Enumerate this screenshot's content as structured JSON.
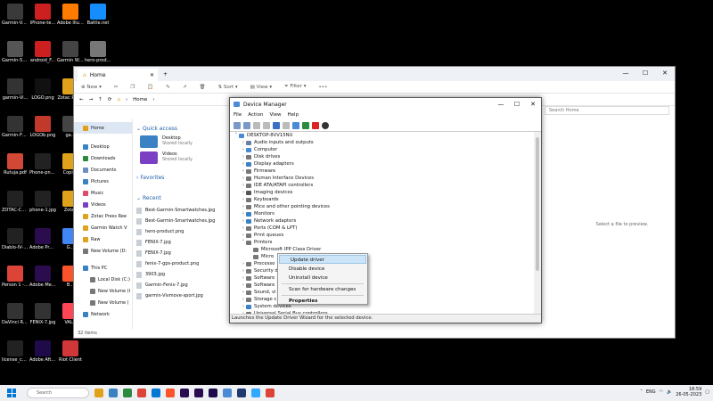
{
  "desktop_icons": [
    {
      "label": "Garmin-Venu-SQ-2.jpg",
      "color": "#3a3a3a"
    },
    {
      "label": "iPhone-te...",
      "color": "#cc1f1f"
    },
    {
      "label": "Adobe Illustrat...",
      "color": "#ff7c00"
    },
    {
      "label": "Battle.net",
      "color": "#148eff"
    },
    {
      "label": "Garmin-55...",
      "color": "#555"
    },
    {
      "label": "android_F...",
      "color": "#cc1f1f"
    },
    {
      "label": "Garmin Watch",
      "color": "#444"
    },
    {
      "label": "hero-produ...",
      "color": "#777"
    },
    {
      "label": "garmin-Vi...",
      "color": "#333"
    },
    {
      "label": "LOGO.png",
      "color": "#111"
    },
    {
      "label": "Zotac Press",
      "color": "#e0a21a"
    },
    {
      "label": "Garmin-Fen...",
      "color": "#333"
    },
    {
      "label": "LOGOb.png",
      "color": "#c0392b"
    },
    {
      "label": "ga...",
      "color": "#444"
    },
    {
      "label": "Rutuja.pdf",
      "color": "#d14836"
    },
    {
      "label": "Phone-png...",
      "color": "#222"
    },
    {
      "label": "Copies",
      "color": "#e0a21a"
    },
    {
      "label": "ZOTAC-CO...",
      "color": "#222"
    },
    {
      "label": "phone-1.jpg",
      "color": "#222"
    },
    {
      "label": "Zotac",
      "color": "#e0a21a"
    },
    {
      "label": "Diablo-IV-D...",
      "color": "#222"
    },
    {
      "label": "Adobe Premiere P...",
      "color": "#2b0c4e"
    },
    {
      "label": "G...",
      "color": "#4285f4"
    },
    {
      "label": "Person 1 - Chrome",
      "color": "#db4437"
    },
    {
      "label": "Adobe Media Encoder 2021",
      "color": "#2b0c4e"
    },
    {
      "label": "B...",
      "color": "#fb542b"
    },
    {
      "label": "DaVinci Resolve",
      "color": "#333"
    },
    {
      "label": "FENIX-7.jpg",
      "color": "#333"
    },
    {
      "label": "VALO",
      "color": "#ff4655"
    },
    {
      "label": "license_cert...",
      "color": "#222"
    },
    {
      "label": "Adobe After Effects 2021",
      "color": "#1f0b4a"
    },
    {
      "label": "Riot Client",
      "color": "#d13639"
    }
  ],
  "explorer": {
    "tab_title": "Home",
    "window_controls": {
      "minimize": "—",
      "maximize": "☐",
      "close": "✕"
    },
    "toolbar": {
      "new": "New",
      "sort": "Sort",
      "view": "View",
      "filter": "Filter",
      "more": "•••"
    },
    "address": "Home",
    "search_placeholder": "Search Home",
    "nav": [
      {
        "label": "Home",
        "color": "#e0a21a"
      },
      {
        "label": "Desktop",
        "color": "#3b82c4"
      },
      {
        "label": "Downloads",
        "color": "#2b8a3e"
      },
      {
        "label": "Documents",
        "color": "#6c8ebf"
      },
      {
        "label": "Pictures",
        "color": "#3b82c4"
      },
      {
        "label": "Music",
        "color": "#e24a6c"
      },
      {
        "label": "Videos",
        "color": "#7b3fc4"
      },
      {
        "label": "Zotac Press Ree",
        "color": "#e0a21a"
      },
      {
        "label": "Garmin Watch V",
        "color": "#e0a21a"
      },
      {
        "label": "Raw",
        "color": "#e0a21a"
      },
      {
        "label": "New Volume (D:",
        "color": "#777"
      },
      {
        "label": "This PC",
        "color": "#3b82c4"
      },
      {
        "label": "Local Disk (C:)",
        "color": "#777"
      },
      {
        "label": "New Volume (I",
        "color": "#777"
      },
      {
        "label": "New Volume (",
        "color": "#777"
      },
      {
        "label": "Network",
        "color": "#3b82c4"
      }
    ],
    "quick_access_title": "Quick access",
    "quick_access": [
      {
        "name": "Desktop",
        "sub": "Stored locally",
        "color": "#3b82c4"
      },
      {
        "name": "Videos",
        "sub": "Stored locally",
        "color": "#7b3fc4"
      }
    ],
    "favorites_title": "Favorites",
    "recent_title": "Recent",
    "recent": [
      "Best-Garmin-Smartwatches.jpg",
      "Best-Garmin-Smartwatches.jpg",
      "hero-product.png",
      "FENIX-7.jpg",
      "FENIX-7.jpg",
      "fenix-7-gps-product.png",
      "3903.jpg",
      "Garmin-Fenix-7.jpg",
      "garmin-Vivmove-sport.jpg"
    ],
    "status": "32 items",
    "preview_hint": "Select a file to preview."
  },
  "device_manager": {
    "title": "Device Manager",
    "window_controls": {
      "minimize": "—",
      "maximize": "☐",
      "close": "✕"
    },
    "menu": [
      "File",
      "Action",
      "View",
      "Help"
    ],
    "root": "DESKTOP-8VV15NU",
    "categories": [
      {
        "label": "Audio inputs and outputs",
        "expanded": false,
        "color": "#6a7fa8"
      },
      {
        "label": "Computer",
        "expanded": false,
        "color": "#4a8bd6"
      },
      {
        "label": "Disk drives",
        "expanded": false,
        "color": "#777"
      },
      {
        "label": "Display adapters",
        "expanded": false,
        "color": "#3b82c4"
      },
      {
        "label": "Firmware",
        "expanded": false,
        "color": "#777"
      },
      {
        "label": "Human Interface Devices",
        "expanded": false,
        "color": "#777"
      },
      {
        "label": "IDE ATA/ATAPI controllers",
        "expanded": false,
        "color": "#777"
      },
      {
        "label": "Imaging devices",
        "expanded": false,
        "color": "#555"
      },
      {
        "label": "Keyboards",
        "expanded": false,
        "color": "#777"
      },
      {
        "label": "Mice and other pointing devices",
        "expanded": false,
        "color": "#777"
      },
      {
        "label": "Monitors",
        "expanded": false,
        "color": "#3b82c4"
      },
      {
        "label": "Network adapters",
        "expanded": false,
        "color": "#3b82c4"
      },
      {
        "label": "Ports (COM & LPT)",
        "expanded": false,
        "color": "#777"
      },
      {
        "label": "Print queues",
        "expanded": false,
        "color": "#777"
      },
      {
        "label": "Printers",
        "expanded": true,
        "color": "#777"
      }
    ],
    "printer_children": [
      "Microsoft IPP Class Driver",
      "Micro"
    ],
    "after_categories": [
      {
        "label": "Processo",
        "color": "#777"
      },
      {
        "label": "Security d",
        "color": "#777"
      },
      {
        "label": "Software",
        "color": "#777"
      },
      {
        "label": "Software",
        "color": "#777"
      },
      {
        "label": "Sound, vi",
        "color": "#777"
      },
      {
        "label": "Storage c",
        "color": "#777"
      },
      {
        "label": "System devices",
        "color": "#3b82c4"
      },
      {
        "label": "Universal Serial Bus controllers",
        "color": "#777"
      }
    ],
    "status": "Launches the Update Driver Wizard for the selected device."
  },
  "context_menu": {
    "items": [
      "Update driver",
      "Disable device",
      "Uninstall device"
    ],
    "scan": "Scan for hardware changes",
    "properties": "Properties"
  },
  "taskbar": {
    "search_placeholder": "Search",
    "apps": [
      "#e0a21a",
      "#3b82c4",
      "#2b8a3e",
      "#db4437",
      "#0078d4",
      "#fb542b",
      "#2b0c4e",
      "#2b0c4e",
      "#1f0b4a",
      "#4a8bd6",
      "#1f3a6e",
      "#31a8ff",
      "#db4437"
    ],
    "language": "ENG",
    "time": "18:59",
    "date": "26-05-2023"
  }
}
